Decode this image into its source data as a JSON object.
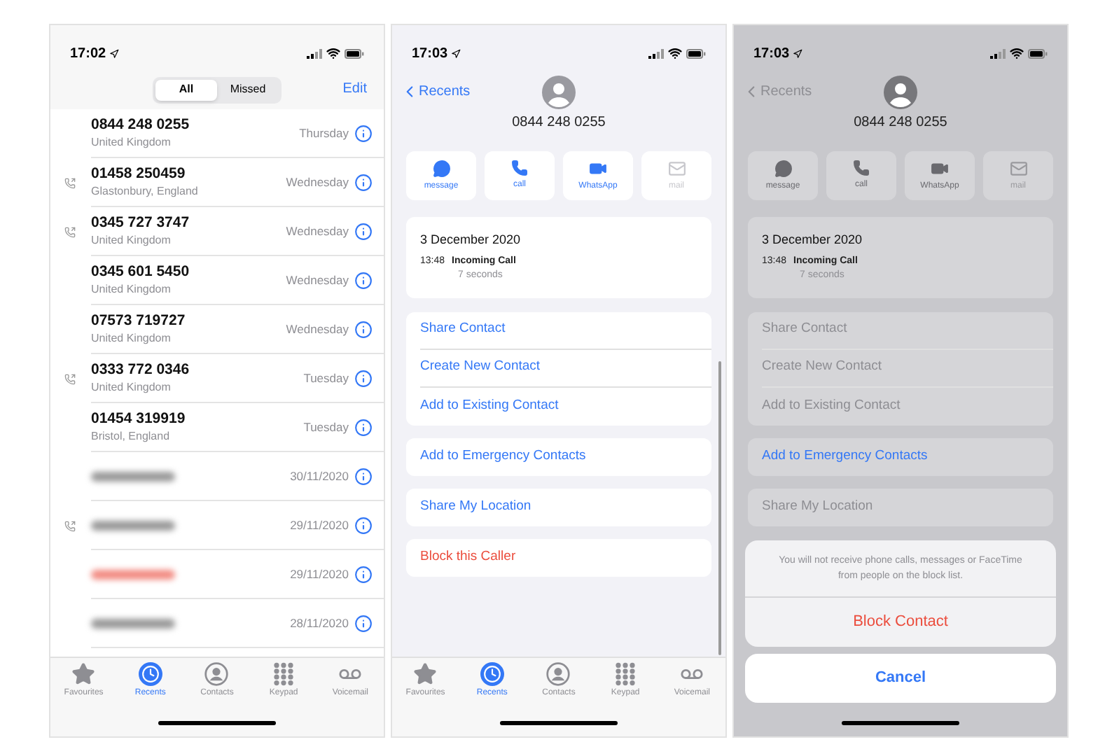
{
  "screens": [
    {
      "kind": "recents",
      "status_bar": {
        "time": "17:02"
      },
      "segments": [
        {
          "label": "All",
          "selected": true
        },
        {
          "label": "Missed",
          "selected": false
        }
      ],
      "edit_label": "Edit",
      "calls": [
        {
          "number": "0844 248 0255",
          "location": "United Kingdom",
          "day": "Thursday",
          "outgoing": false,
          "redacted": false,
          "missed": false
        },
        {
          "number": "01458 250459",
          "location": "Glastonbury, England",
          "day": "Wednesday",
          "outgoing": true,
          "redacted": false,
          "missed": false
        },
        {
          "number": "0345 727 3747",
          "location": "United Kingdom",
          "day": "Wednesday",
          "outgoing": true,
          "redacted": false,
          "missed": false
        },
        {
          "number": "0345 601 5450",
          "location": "United Kingdom",
          "day": "Wednesday",
          "outgoing": false,
          "redacted": false,
          "missed": false
        },
        {
          "number": "07573 719727",
          "location": "United Kingdom",
          "day": "Wednesday",
          "outgoing": false,
          "redacted": false,
          "missed": false
        },
        {
          "number": "0333 772 0346",
          "location": "United Kingdom",
          "day": "Tuesday",
          "outgoing": true,
          "redacted": false,
          "missed": false
        },
        {
          "number": "01454 319919",
          "location": "Bristol, England",
          "day": "Tuesday",
          "outgoing": false,
          "redacted": false,
          "missed": false
        },
        {
          "day": "30/11/2020",
          "outgoing": false,
          "redacted": true,
          "missed": false
        },
        {
          "day": "29/11/2020",
          "outgoing": true,
          "redacted": true,
          "missed": false
        },
        {
          "day": "29/11/2020",
          "outgoing": false,
          "redacted": true,
          "missed": true
        },
        {
          "day": "28/11/2020",
          "outgoing": false,
          "redacted": true,
          "missed": false
        }
      ],
      "tab_bar": [
        {
          "label": "Favourites",
          "kind": "favourites",
          "selected": false
        },
        {
          "label": "Recents",
          "kind": "recents",
          "selected": true
        },
        {
          "label": "Contacts",
          "kind": "contacts",
          "selected": false
        },
        {
          "label": "Keypad",
          "kind": "keypad",
          "selected": false
        },
        {
          "label": "Voicemail",
          "kind": "voicemail",
          "selected": false
        }
      ]
    },
    {
      "kind": "details",
      "dimmed": false,
      "status_bar": {
        "time": "17:03"
      },
      "back_label": "Recents",
      "number": "0844 248 0255",
      "quick_actions": [
        {
          "label": "message",
          "kind": "message",
          "disabled": false
        },
        {
          "label": "call",
          "kind": "call",
          "disabled": false
        },
        {
          "label": "WhatsApp",
          "kind": "video",
          "disabled": false
        },
        {
          "label": "mail",
          "kind": "mail",
          "disabled": true
        }
      ],
      "call_log": {
        "date": "3 December 2020",
        "time": "13:48",
        "type": "Incoming Call",
        "duration": "7 seconds"
      },
      "action_groups": [
        [
          {
            "label": "Share Contact",
            "kind": "link",
            "dimmed": false
          },
          {
            "label": "Create New Contact",
            "kind": "link",
            "dimmed": false
          },
          {
            "label": "Add to Existing Contact",
            "kind": "link",
            "dimmed": false
          }
        ],
        [
          {
            "label": "Add to Emergency Contacts",
            "kind": "link",
            "dimmed": false
          }
        ],
        [
          {
            "label": "Share My Location",
            "kind": "link",
            "dimmed": false
          }
        ],
        [
          {
            "label": "Block this Caller",
            "kind": "destructive",
            "dimmed": false
          }
        ]
      ],
      "tab_bar": [
        {
          "label": "Favourites",
          "kind": "favourites",
          "selected": false
        },
        {
          "label": "Recents",
          "kind": "recents",
          "selected": true
        },
        {
          "label": "Contacts",
          "kind": "contacts",
          "selected": false
        },
        {
          "label": "Keypad",
          "kind": "keypad",
          "selected": false
        },
        {
          "label": "Voicemail",
          "kind": "voicemail",
          "selected": false
        }
      ]
    },
    {
      "kind": "details",
      "dimmed": true,
      "status_bar": {
        "time": "17:03"
      },
      "back_label": "Recents",
      "number": "0844 248 0255",
      "quick_actions": [
        {
          "label": "message",
          "kind": "message",
          "disabled": false
        },
        {
          "label": "call",
          "kind": "call",
          "disabled": false
        },
        {
          "label": "WhatsApp",
          "kind": "video",
          "disabled": false
        },
        {
          "label": "mail",
          "kind": "mail",
          "disabled": true
        }
      ],
      "call_log": {
        "date": "3 December 2020",
        "time": "13:48",
        "type": "Incoming Call",
        "duration": "7 seconds"
      },
      "action_groups": [
        [
          {
            "label": "Share Contact",
            "kind": "link",
            "dimmed": true
          },
          {
            "label": "Create New Contact",
            "kind": "link",
            "dimmed": true
          },
          {
            "label": "Add to Existing Contact",
            "kind": "link",
            "dimmed": true
          }
        ],
        [
          {
            "label": "Add to Emergency Contacts",
            "kind": "link",
            "dimmed": false
          }
        ],
        [
          {
            "label": "Share My Location",
            "kind": "link",
            "dimmed": true
          }
        ]
      ],
      "action_sheet": {
        "message": "You will not receive phone calls, messages or FaceTime from people on the block list.",
        "actions": [
          {
            "label": "Block Contact",
            "kind": "destructive"
          }
        ],
        "cancel_label": "Cancel"
      }
    }
  ]
}
